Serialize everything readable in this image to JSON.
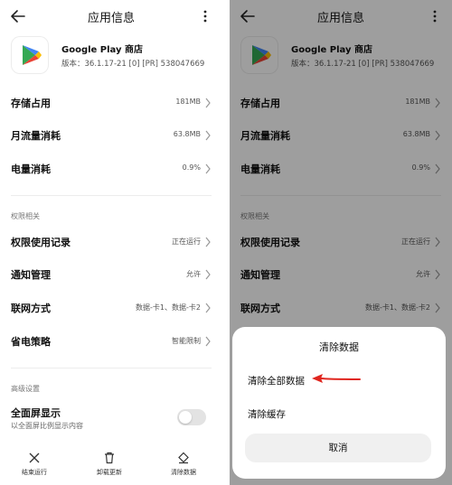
{
  "header": {
    "title": "应用信息"
  },
  "app": {
    "name": "Google Play 商店",
    "version": "版本：36.1.17-21 [0] [PR] 538047669"
  },
  "main": {
    "rows": [
      {
        "label": "存储占用",
        "value": "181MB"
      },
      {
        "label": "月流量消耗",
        "value": "63.8MB"
      },
      {
        "label": "电量消耗",
        "value": "0.9%"
      }
    ],
    "section_permissions": "权限相关",
    "permission_rows": [
      {
        "label": "权限使用记录",
        "value": "正在运行"
      },
      {
        "label": "通知管理",
        "value": "允许"
      },
      {
        "label": "联网方式",
        "value": "数据-卡1、数据-卡2"
      },
      {
        "label": "省电策略",
        "value": "智能限制"
      }
    ],
    "section_advanced": "高级设置",
    "fullscreen": {
      "title": "全面屏显示",
      "subtitle": "以全面屏比例显示内容",
      "enabled": false
    }
  },
  "bottom_bar": [
    {
      "label": "结束运行",
      "icon": "close-icon"
    },
    {
      "label": "卸载更新",
      "icon": "trash-icon"
    },
    {
      "label": "清除数据",
      "icon": "eraser-icon"
    }
  ],
  "dialog": {
    "title": "清除数据",
    "options": [
      "清除全部数据",
      "清除缓存"
    ],
    "cancel": "取消"
  },
  "colors": {
    "accent_arrow": "#e0261f",
    "overlay": "#000000",
    "toggle_off": "#e3e3e3"
  }
}
